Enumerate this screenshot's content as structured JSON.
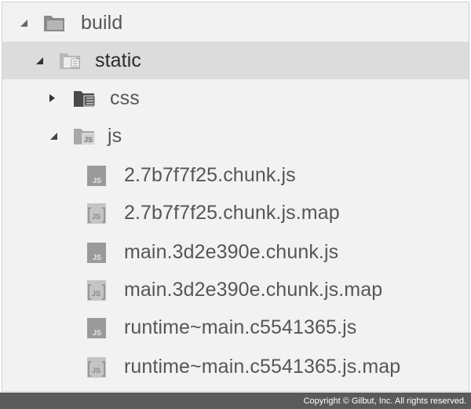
{
  "tree": {
    "build": {
      "label": "build",
      "expanded": true,
      "icon": "folder-icon"
    },
    "static": {
      "label": "static",
      "expanded": true,
      "selected": true,
      "icon": "folder-open-icon"
    },
    "css": {
      "label": "css",
      "expanded": false,
      "icon": "css-folder-icon"
    },
    "js": {
      "label": "js",
      "expanded": true,
      "icon": "js-folder-icon"
    },
    "files": [
      {
        "label": "2.7b7f7f25.chunk.js",
        "icon": "js-file-icon"
      },
      {
        "label": "2.7b7f7f25.chunk.js.map",
        "icon": "map-file-icon"
      },
      {
        "label": "main.3d2e390e.chunk.js",
        "icon": "js-file-icon"
      },
      {
        "label": "main.3d2e390e.chunk.js.map",
        "icon": "map-file-icon"
      },
      {
        "label": "runtime~main.c5541365.js",
        "icon": "js-file-icon"
      },
      {
        "label": "runtime~main.c5541365.js.map",
        "icon": "map-file-icon"
      }
    ]
  },
  "footer": {
    "copyright": "Copyright © Gilbut, Inc. All rights reserved."
  }
}
